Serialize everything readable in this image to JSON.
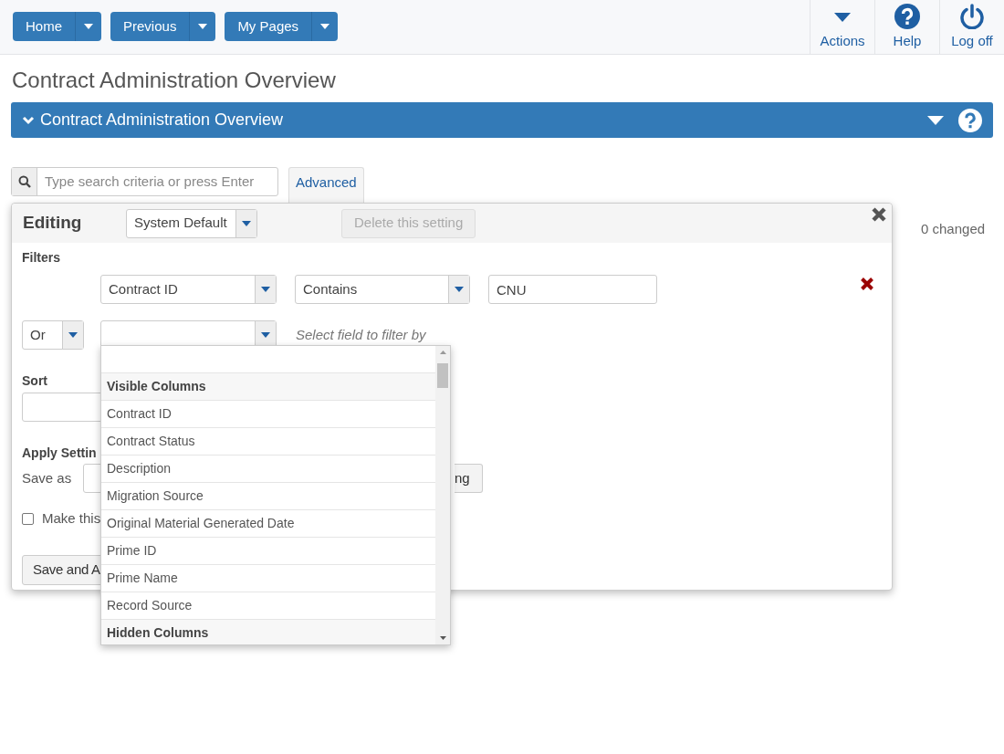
{
  "toolbar": {
    "nav_buttons": [
      {
        "label": "Home"
      },
      {
        "label": "Previous"
      },
      {
        "label": "My Pages"
      }
    ],
    "actions": [
      {
        "kind": "actions",
        "label": "Actions"
      },
      {
        "kind": "help",
        "label": "Help"
      },
      {
        "kind": "logoff",
        "label": "Log off"
      }
    ]
  },
  "page_title": "Contract Administration Overview",
  "section": {
    "title": "Contract Administration Overview",
    "expanded": true
  },
  "search": {
    "placeholder": "Type search criteria or press Enter",
    "advanced_label": "Advanced"
  },
  "changed_count": "0 changed",
  "editor": {
    "title": "Editing",
    "setting": "System Default",
    "delete_label": "Delete this setting",
    "delete_disabled": true,
    "filters_label": "Filters",
    "filters": [
      {
        "field": "Contract ID",
        "operator": "Contains",
        "value": "CNU"
      }
    ],
    "new_filter": {
      "connector": "Or",
      "hint": "Select field to filter by"
    },
    "sort_label": "Sort",
    "apply_label": "Apply Settin",
    "save_as_label": "Save as",
    "save_setting_button": "ng",
    "default_checkbox": {
      "label": "Make this",
      "checked": false
    },
    "save_apply_button": "Save and A"
  },
  "field_dropdown": {
    "groups": [
      {
        "label": "Visible Columns",
        "items": [
          "Contract ID",
          "Contract Status",
          "Description",
          "Migration Source",
          "Original Material Generated Date",
          "Prime ID",
          "Prime Name",
          "Record Source"
        ]
      },
      {
        "label": "Hidden Columns"
      }
    ]
  }
}
